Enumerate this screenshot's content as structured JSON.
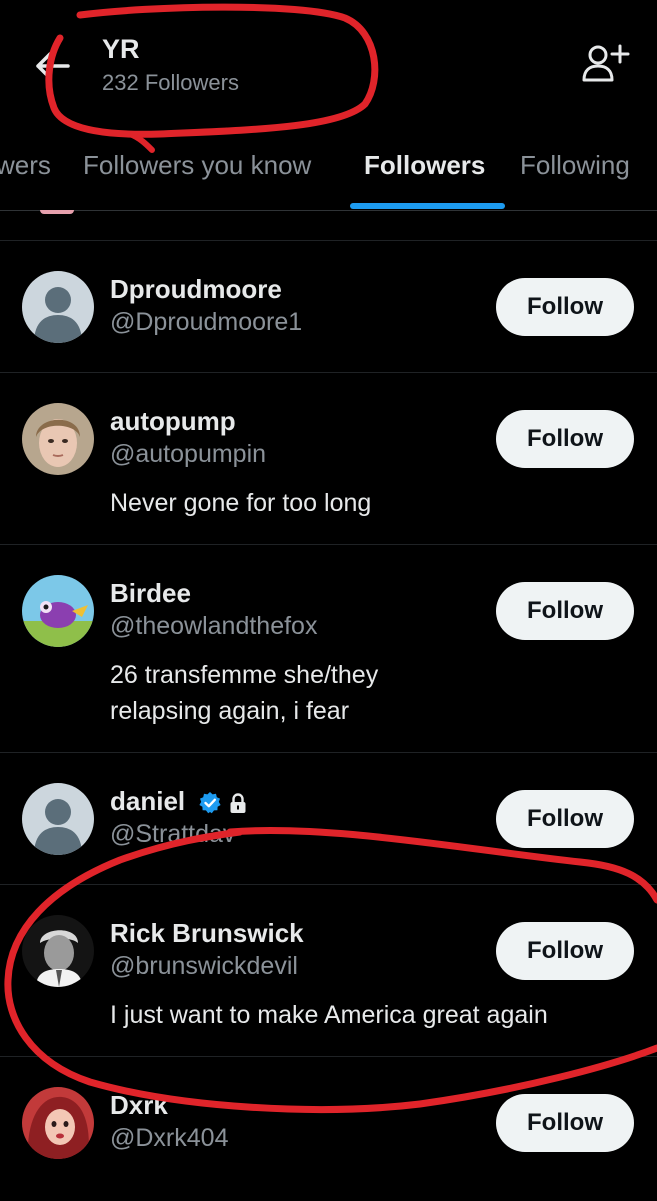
{
  "header": {
    "title": "YR",
    "subtitle": "232 Followers"
  },
  "tabs": [
    {
      "label": "wers"
    },
    {
      "label": "Followers you know"
    },
    {
      "label": "Followers",
      "active": true
    },
    {
      "label": "Following"
    }
  ],
  "followers": [
    {
      "name": "Dproudmoore",
      "handle": "@Dproudmoore1",
      "bio": [],
      "button": "Follow"
    },
    {
      "name": "autopump",
      "handle": "@autopumpin",
      "bio": [
        "Never gone for too long"
      ],
      "button": "Follow"
    },
    {
      "name": "Birdee",
      "handle": "@theowlandthefox",
      "bio": [
        "26 transfemme she/they",
        "relapsing again, i fear"
      ],
      "button": "Follow"
    },
    {
      "name": "daniel",
      "handle": "@Strattdav",
      "bio": [],
      "verified": true,
      "protected": true,
      "button": "Follow"
    },
    {
      "name": "Rick Brunswick",
      "handle": "@brunswickdevil",
      "bio": [
        "I just want to make America great again"
      ],
      "button": "Follow"
    },
    {
      "name": "Dxrk",
      "handle": "@Dxrk404",
      "bio": [],
      "button": "Follow"
    }
  ],
  "colors": {
    "background": "#000000",
    "text_primary": "#e7e9ea",
    "text_secondary": "#8b9299",
    "accent": "#1d9bf0",
    "button_bg": "#eff3f4",
    "annotation": "#e0242a"
  }
}
